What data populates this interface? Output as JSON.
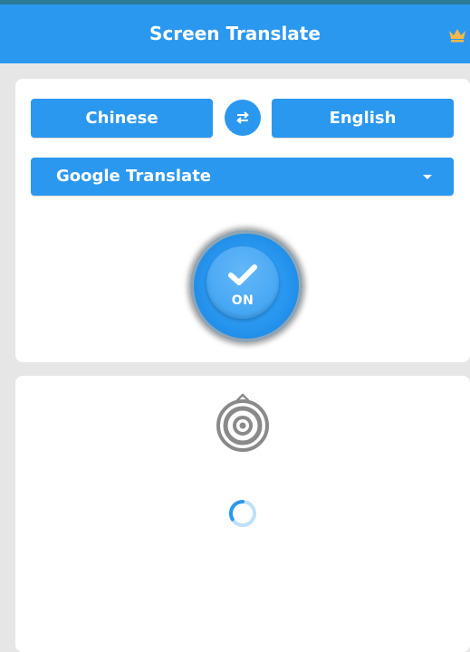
{
  "header": {
    "title": "Screen Translate",
    "premium_icon": "crown-icon",
    "colors": {
      "bar": "#2b98f0",
      "status_strip": "#2d7a96",
      "crown": "#f5b84a"
    }
  },
  "languages": {
    "source": "Chinese",
    "target": "English",
    "swap_icon": "swap-arrows-icon"
  },
  "engine": {
    "selected": "Google Translate",
    "dropdown_icon": "caret-down-icon"
  },
  "power": {
    "state_label": "ON",
    "icon": "check-icon"
  },
  "result": {
    "float_icon": "target-icon",
    "loading_icon": "loading-spinner-icon"
  },
  "theme": {
    "accent": "#2b98f0",
    "background": "#e6e6e6",
    "card": "#ffffff"
  }
}
